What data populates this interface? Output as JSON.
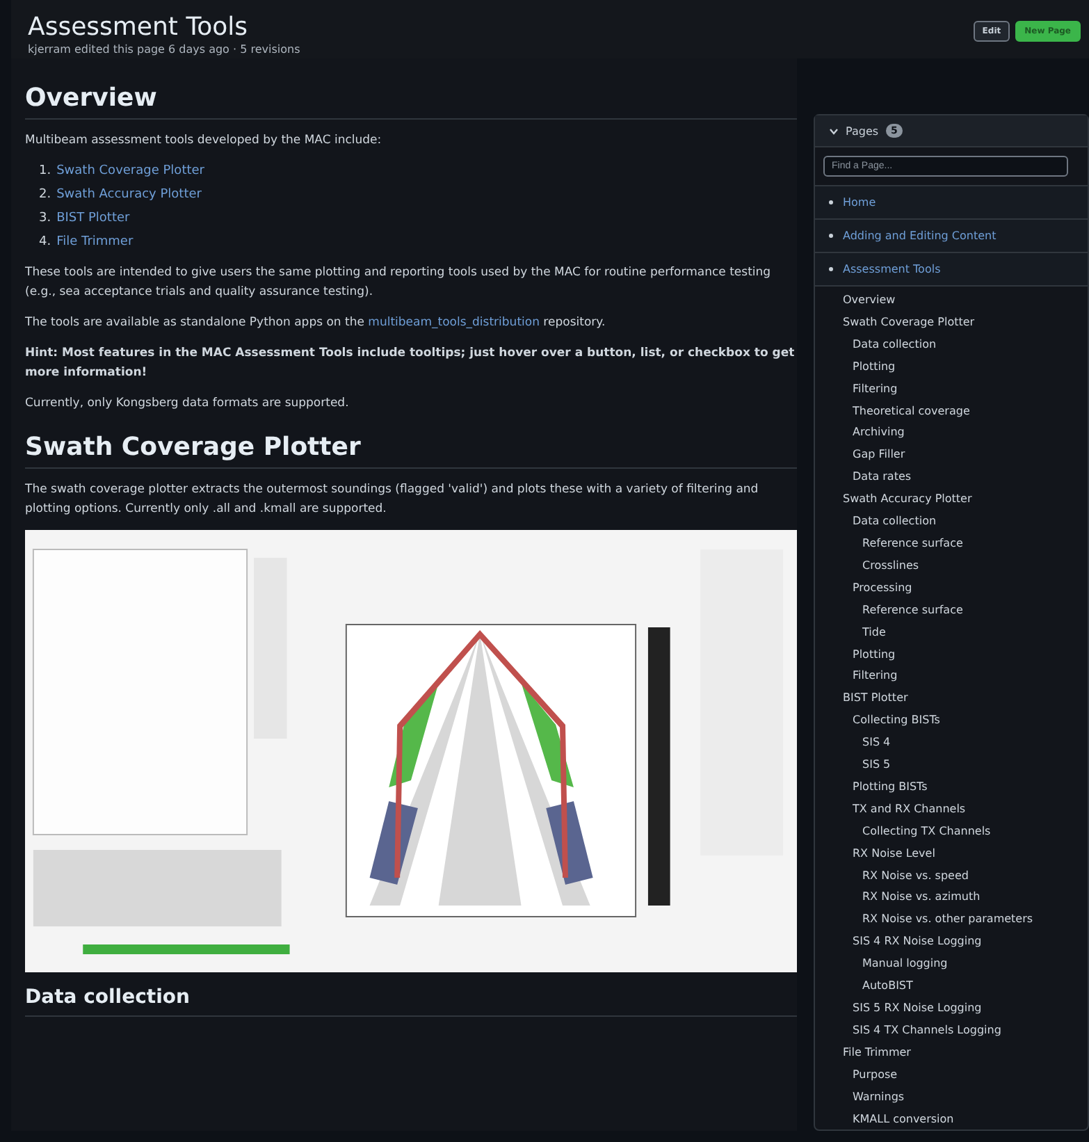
{
  "header": {
    "title": "Assessment Tools",
    "meta": "kjerram edited this page 6 days ago · 5 revisions"
  },
  "buttons": [
    {
      "label": "Edit",
      "kind": "default"
    },
    {
      "label": "New Page",
      "kind": "primary"
    }
  ],
  "content": [
    {
      "kind": "h2",
      "text": "Overview"
    },
    {
      "kind": "p",
      "parts": [
        {
          "text": "Multibeam assessment tools developed by the MAC include:"
        }
      ]
    },
    {
      "kind": "ol",
      "items": [
        {
          "number": "1.",
          "label": "Swath Coverage Plotter"
        },
        {
          "number": "2.",
          "label": "Swath Accuracy Plotter"
        },
        {
          "number": "3.",
          "label": "BIST Plotter"
        },
        {
          "number": "4.",
          "label": "File Trimmer"
        }
      ]
    },
    {
      "kind": "p",
      "parts": [
        {
          "text": "These tools are intended to give users the same plotting and reporting tools used by the MAC for routine performance testing (e.g., sea acceptance trials and quality assurance testing)."
        }
      ]
    },
    {
      "kind": "p",
      "parts": [
        {
          "text": "The tools are available as standalone Python apps on the "
        },
        {
          "text": "multibeam_tools_distribution",
          "link": true
        },
        {
          "text": " repository."
        }
      ]
    },
    {
      "kind": "p",
      "bold": true,
      "parts": [
        {
          "text": "Hint: Most features in the MAC Assessment Tools include tooltips; just hover over a button, list, or checkbox to get more information!"
        }
      ]
    },
    {
      "kind": "p",
      "parts": [
        {
          "text": "Currently, only Kongsberg data formats are supported."
        }
      ]
    },
    {
      "kind": "h2",
      "text": "Swath Coverage Plotter"
    },
    {
      "kind": "p",
      "parts": [
        {
          "text": "The swath coverage plotter extracts the outermost soundings (flagged 'valid') and plots these with a variety of filtering and plotting options. Currently only .all and .kmall are supported."
        }
      ]
    },
    {
      "kind": "picture"
    },
    {
      "kind": "h3",
      "text": "Data collection"
    }
  ],
  "sidebar": {
    "title": "Pages",
    "count": "5",
    "search_placeholder": "Find a Page...",
    "pages": [
      "Home",
      "Adding and Editing Content",
      "Assessment Tools"
    ],
    "toc": [
      {
        "label": "Overview"
      },
      {
        "label": "Swath Coverage Plotter",
        "children": [
          {
            "label": "Data collection"
          },
          {
            "label": "Plotting"
          },
          {
            "label": "Filtering"
          },
          {
            "label": "Theoretical coverage"
          },
          {
            "label": "Archiving"
          },
          {
            "label": "Gap Filler"
          },
          {
            "label": "Data rates"
          }
        ]
      },
      {
        "label": "Swath Accuracy Plotter",
        "children": [
          {
            "label": "Data collection",
            "children": [
              {
                "label": "Reference surface"
              },
              {
                "label": "Crosslines"
              }
            ]
          },
          {
            "label": "Processing",
            "children": [
              {
                "label": "Reference surface"
              },
              {
                "label": "Tide"
              }
            ]
          },
          {
            "label": "Plotting"
          },
          {
            "label": "Filtering"
          }
        ]
      },
      {
        "label": "BIST Plotter",
        "children": [
          {
            "label": "Collecting BISTs",
            "children": [
              {
                "label": "SIS 4"
              },
              {
                "label": "SIS 5"
              }
            ]
          },
          {
            "label": "Plotting BISTs"
          },
          {
            "label": "TX and RX Channels",
            "children": [
              {
                "label": "Collecting TX Channels"
              }
            ]
          },
          {
            "label": "RX Noise Level",
            "children": [
              {
                "label": "RX Noise vs. speed"
              },
              {
                "label": "RX Noise vs. azimuth"
              },
              {
                "label": "RX Noise vs. other parameters"
              }
            ]
          },
          {
            "label": "SIS 4 RX Noise Logging",
            "children": [
              {
                "label": "Manual logging"
              },
              {
                "label": "AutoBIST"
              }
            ]
          },
          {
            "label": "SIS 5 RX Noise Logging"
          },
          {
            "label": "SIS 4 TX Channels Logging"
          }
        ]
      },
      {
        "label": "File Trimmer",
        "children": [
          {
            "label": "Purpose"
          },
          {
            "label": "Warnings"
          },
          {
            "label": "KMALL conversion"
          }
        ]
      }
    ]
  }
}
